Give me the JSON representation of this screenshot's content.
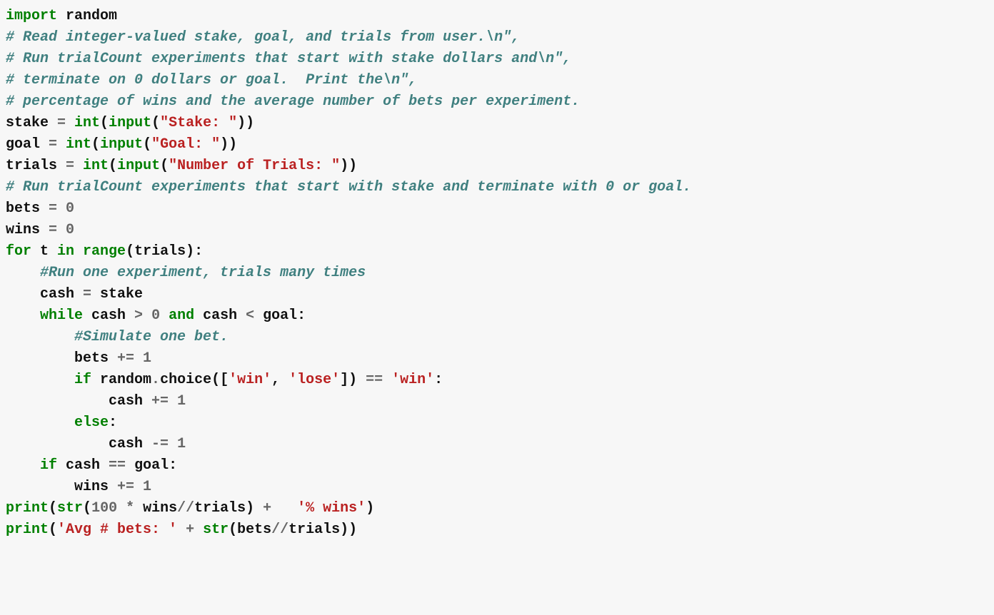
{
  "code": {
    "l1": {
      "import": "import",
      "random": "random"
    },
    "l2": "# Read integer-valued stake, goal, and trials from user.\\n\",",
    "l3": "# Run trialCount experiments that start with stake dollars and\\n\",",
    "l4": "# terminate on 0 dollars or goal.  Print the\\n\",",
    "l5": "# percentage of wins and the average number of bets per experiment.",
    "l6": {
      "var": "stake ",
      "eq": "=",
      "int": " int",
      "lp": "(",
      "input": "input",
      "lp2": "(",
      "str": "\"Stake: \"",
      "rp": "))"
    },
    "l7": {
      "var": "goal ",
      "eq": "=",
      "int": " int",
      "lp": "(",
      "input": "input",
      "lp2": "(",
      "str": "\"Goal: \"",
      "rp": "))"
    },
    "l8": {
      "var": "trials ",
      "eq": "=",
      "int": " int",
      "lp": "(",
      "input": "input",
      "lp2": "(",
      "str": "\"Number of Trials: \"",
      "rp": "))"
    },
    "l9": "# Run trialCount experiments that start with stake and terminate with 0 or goal.",
    "l10": {
      "var": "bets ",
      "eq": "=",
      "num": " 0"
    },
    "l11": {
      "var": "wins ",
      "eq": "=",
      "num": " 0"
    },
    "l12": {
      "for": "for",
      "t": " t ",
      "in": "in",
      "range": " range",
      "lp": "(",
      "trials": "trials",
      "rp": "):"
    },
    "l13": "    #Run one experiment, trials many times",
    "l14": {
      "indent": "    ",
      "cash": "cash ",
      "eq": "=",
      "stake": " stake"
    },
    "l15": {
      "indent": "    ",
      "while": "while",
      "cash": " cash ",
      "gt": ">",
      "zero": " 0",
      "and": " and",
      "cash2": " cash ",
      "lt": "<",
      "goal": " goal:"
    },
    "l16": "        #Simulate one bet.",
    "l17": {
      "indent": "        ",
      "bets": "bets ",
      "op": "+=",
      "num": " 1"
    },
    "l18": {
      "indent": "        ",
      "if": "if",
      "random": " random",
      "dot": ".",
      "choice": "choice([",
      "win": "'win'",
      "comma": ", ",
      "lose": "'lose'",
      "rb": "]) ",
      "eq": "==",
      "win2": " 'win'",
      "colon": ":"
    },
    "l19": {
      "indent": "            ",
      "cash": "cash ",
      "op": "+=",
      "num": " 1"
    },
    "l20": {
      "indent": "        ",
      "else": "else",
      "colon": ":"
    },
    "l21": {
      "indent": "            ",
      "cash": "cash ",
      "op": "-=",
      "num": " 1"
    },
    "l22": {
      "indent": "    ",
      "if": "if",
      "cash": " cash ",
      "eq": "==",
      "goal": " goal:"
    },
    "l23": {
      "indent": "        ",
      "wins": "wins ",
      "op": "+=",
      "num": " 1"
    },
    "l24": {
      "print": "print",
      "lp": "(",
      "str": "str",
      "lp2": "(",
      "n100": "100",
      "mul": " *",
      "wins": " wins",
      "div": "//",
      "trials": "trials) ",
      "plus": "+",
      "str2": "   '% wins'",
      "rp": ")"
    },
    "l25": {
      "print": "print",
      "lp": "(",
      "str1": "'Avg # bets: '",
      "plus": " +",
      "str": " str",
      "lp2": "(",
      "bets": "bets",
      "div": "//",
      "trials": "trials))"
    }
  }
}
